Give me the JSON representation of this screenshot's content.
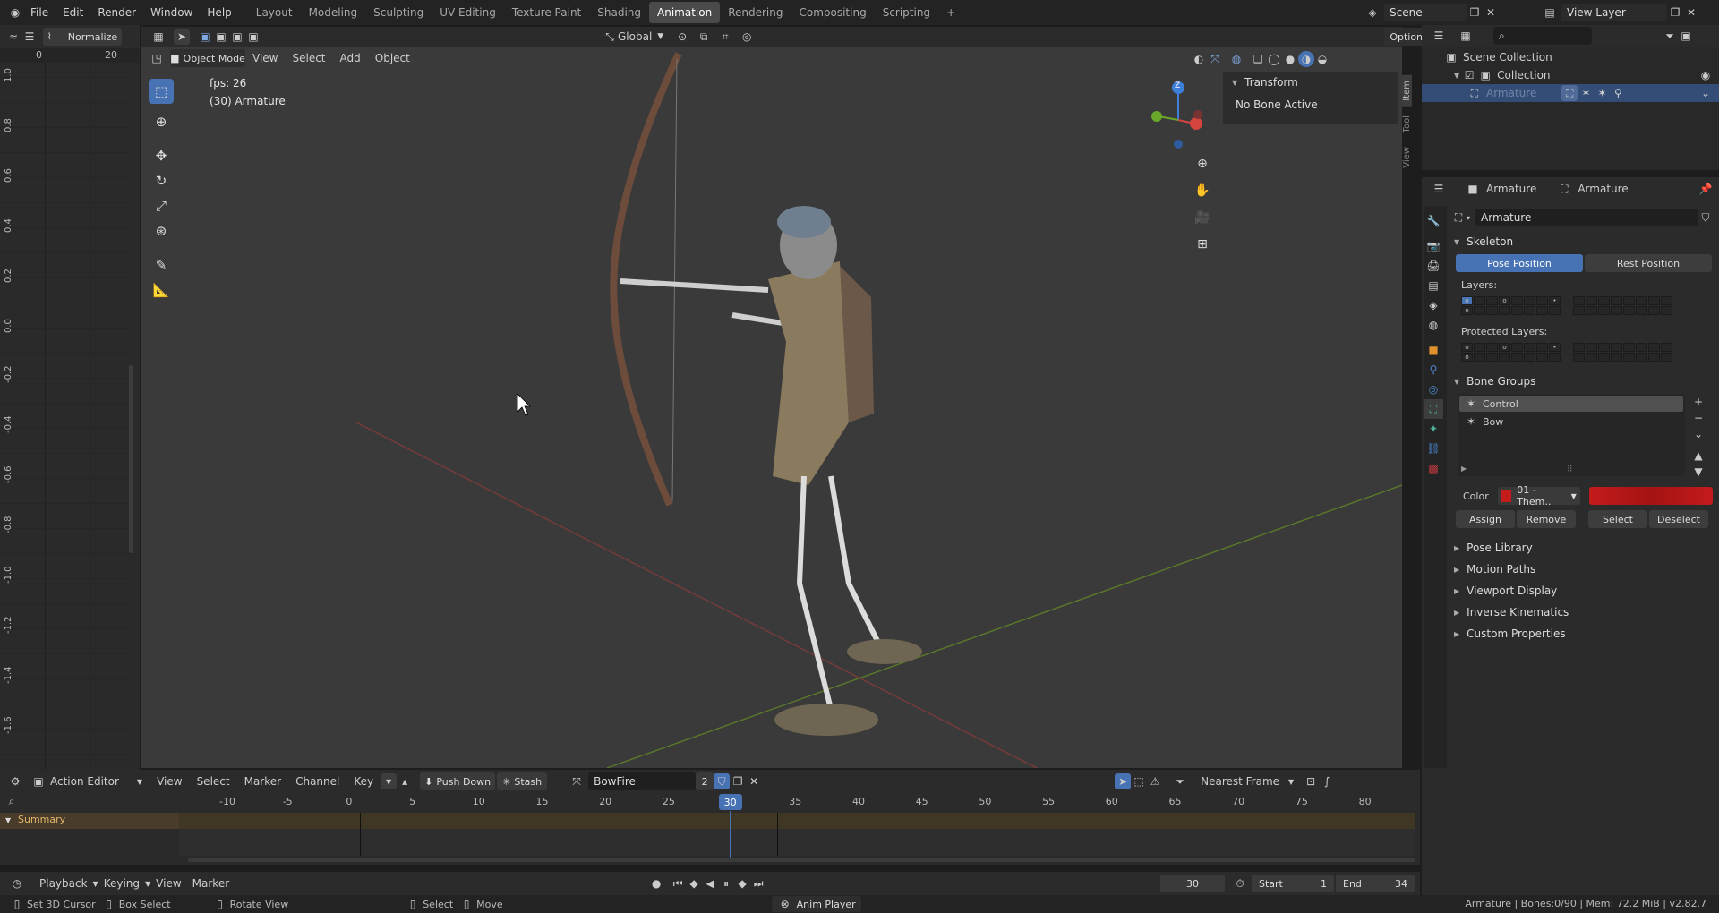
{
  "topbar": {
    "menu": [
      "File",
      "Edit",
      "Render",
      "Window",
      "Help"
    ],
    "workspaces": [
      "Layout",
      "Modeling",
      "Sculpting",
      "UV Editing",
      "Texture Paint",
      "Shading",
      "Animation",
      "Rendering",
      "Compositing",
      "Scripting"
    ],
    "active_workspace": "Animation",
    "add_tab": "+",
    "scene": "Scene",
    "view_layer": "View Layer"
  },
  "graph_editor": {
    "normalize": "Normalize",
    "frame_ticks": [
      "0",
      "20"
    ],
    "y_ticks": [
      "1.0",
      "0.8",
      "0.6",
      "0.4",
      "0.2",
      "0.0",
      "-0.2",
      "-0.4",
      "-0.6",
      "-0.8",
      "-1.0",
      "-1.2",
      "-1.4",
      "-1.6"
    ]
  },
  "viewport": {
    "mode": "Object Mode",
    "menu": [
      "View",
      "Select",
      "Add",
      "Object"
    ],
    "orientation": "Global",
    "options": "Options",
    "fps": "fps: 26",
    "object_info": "(30) Armature",
    "gizmo_z": "Z",
    "transform_header": "Transform",
    "no_bone": "No Bone Active",
    "side_tabs": [
      "Item",
      "Tool",
      "View"
    ]
  },
  "outliner": {
    "scene_collection": "Scene Collection",
    "collection": "Collection",
    "armature": "Armature"
  },
  "properties": {
    "breadcrumb_1": "Armature",
    "breadcrumb_2": "Armature",
    "data_name": "Armature",
    "skeleton_title": "Skeleton",
    "pose_position": "Pose Position",
    "rest_position": "Rest Position",
    "layers_label": "Layers:",
    "protected_label": "Protected Layers:",
    "bone_groups_title": "Bone Groups",
    "groups": [
      "Control",
      "Bow"
    ],
    "color_label": "Color",
    "color_value": "01 - Them..",
    "accent_red": "#c41b1b",
    "assign": "Assign",
    "remove": "Remove",
    "select": "Select",
    "deselect": "Deselect",
    "collapsed_sections": [
      "Pose Library",
      "Motion Paths",
      "Viewport Display",
      "Inverse Kinematics",
      "Custom Properties"
    ]
  },
  "action_editor": {
    "mode": "Action Editor",
    "menu": [
      "View",
      "Select",
      "Marker",
      "Channel",
      "Key"
    ],
    "push_down": "Push Down",
    "stash": "Stash",
    "action": "BowFire",
    "users": "2",
    "snap": "Nearest Frame",
    "ruler": [
      "-10",
      "-5",
      "0",
      "5",
      "10",
      "15",
      "20",
      "25",
      "30",
      "35",
      "40",
      "45",
      "50",
      "55",
      "60",
      "65",
      "70",
      "75",
      "80"
    ],
    "current_frame": "30",
    "summary": "Summary"
  },
  "timeline": {
    "menu": [
      "Playback",
      "Keying",
      "View",
      "Marker"
    ],
    "current_frame": "30",
    "start_label": "Start",
    "start": "1",
    "end_label": "End",
    "end": "34"
  },
  "statusbar": {
    "set_cursor": "Set 3D Cursor",
    "box_select": "Box Select",
    "rotate_view": "Rotate View",
    "select": "Select",
    "move": "Move",
    "anim_player": "Anim Player",
    "stats": "Armature | Bones:0/90 | Mem: 72.2 MiB | v2.82.7"
  }
}
